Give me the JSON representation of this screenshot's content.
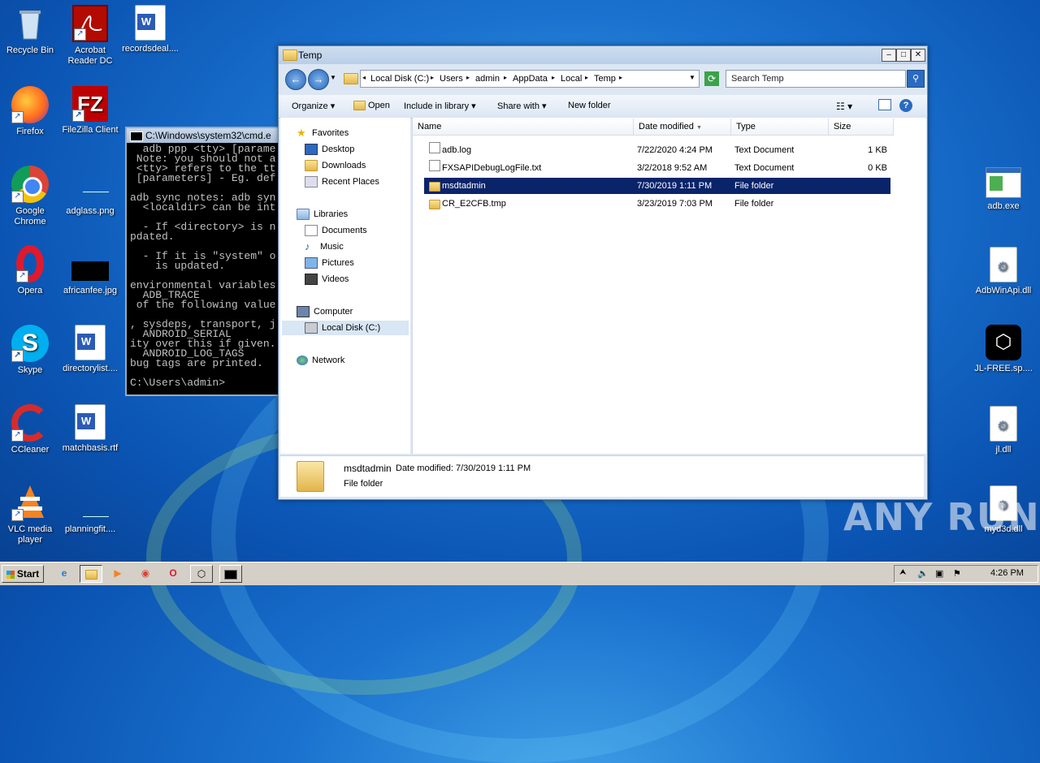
{
  "desktop": {
    "left_icons": [
      {
        "label": "Recycle Bin",
        "icon": "recycle-bin-icon"
      },
      {
        "label": "Acrobat Reader DC",
        "icon": "acrobat-icon"
      },
      {
        "label": "recordsdeal....",
        "icon": "word-doc-icon"
      },
      {
        "label": "Firefox",
        "icon": "firefox-icon"
      },
      {
        "label": "FileZilla Client",
        "icon": "filezilla-icon"
      },
      {
        "label": "Google Chrome",
        "icon": "chrome-icon"
      },
      {
        "label": "adglass.png",
        "icon": "image-file-icon"
      },
      {
        "label": "Opera",
        "icon": "opera-icon"
      },
      {
        "label": "africanfee.jpg",
        "icon": "image-file-icon"
      },
      {
        "label": "Skype",
        "icon": "skype-icon"
      },
      {
        "label": "directorylist....",
        "icon": "word-doc-icon"
      },
      {
        "label": "CCleaner",
        "icon": "ccleaner-icon"
      },
      {
        "label": "matchbasis.rtf",
        "icon": "word-doc-icon"
      },
      {
        "label": "VLC media player",
        "icon": "vlc-icon"
      },
      {
        "label": "planningfit....",
        "icon": "file-icon"
      }
    ],
    "right_icons": [
      {
        "label": "adb.exe",
        "icon": "exe-icon"
      },
      {
        "label": "AdbWinApi.dll",
        "icon": "dll-icon"
      },
      {
        "label": "JL-FREE.sp....",
        "icon": "box-icon"
      },
      {
        "label": "jl.dll",
        "icon": "dll-icon"
      },
      {
        "label": "myd3d.dll",
        "icon": "dll-icon"
      }
    ],
    "watermark": "ANY RUN"
  },
  "cmd": {
    "title": "C:\\Windows\\system32\\cmd.e",
    "lines": [
      "  adb ppp <tty> [parame",
      " Note: you should not a",
      " <tty> refers to the tt",
      " [parameters] - Eg. def",
      "",
      "adb sync notes: adb syn",
      "  <localdir> can be int",
      "",
      "  - If <directory> is n",
      "pdated.",
      "",
      "  - If it is \"system\" o",
      "    is updated.",
      "",
      "environmental variables",
      "  ADB_TRACE",
      " of the following value",
      "",
      ", sysdeps, transport, j",
      "  ANDROID_SERIAL",
      "ity over this if given.",
      "  ANDROID_LOG_TAGS",
      "bug tags are printed.",
      "",
      "C:\\Users\\admin>"
    ]
  },
  "explorer": {
    "title": "Temp",
    "breadcrumb": [
      "Local Disk (C:)",
      "Users",
      "admin",
      "AppData",
      "Local",
      "Temp"
    ],
    "search_placeholder": "Search Temp",
    "toolbar": {
      "organize": "Organize",
      "open": "Open",
      "include": "Include in library",
      "share": "Share with",
      "new_folder": "New folder"
    },
    "nav": {
      "favorites": "Favorites",
      "desktop": "Desktop",
      "downloads": "Downloads",
      "recent": "Recent Places",
      "libraries": "Libraries",
      "documents": "Documents",
      "music": "Music",
      "pictures": "Pictures",
      "videos": "Videos",
      "computer": "Computer",
      "local_disk": "Local Disk (C:)",
      "network": "Network"
    },
    "columns": {
      "name": "Name",
      "date": "Date modified",
      "type": "Type",
      "size": "Size"
    },
    "files": [
      {
        "name": "adb.log",
        "date": "7/22/2020 4:24 PM",
        "type": "Text Document",
        "size": "1 KB",
        "kind": "text"
      },
      {
        "name": "FXSAPIDebugLogFile.txt",
        "date": "3/2/2018 9:52 AM",
        "type": "Text Document",
        "size": "0 KB",
        "kind": "text"
      },
      {
        "name": "msdtadmin",
        "date": "7/30/2019 1:11 PM",
        "type": "File folder",
        "size": "",
        "kind": "folder"
      },
      {
        "name": "CR_E2CFB.tmp",
        "date": "3/23/2019 7:03 PM",
        "type": "File folder",
        "size": "",
        "kind": "folder"
      }
    ],
    "selected_index": 2,
    "details": {
      "name": "msdtadmin",
      "date_label": "Date modified:",
      "date": "7/30/2019 1:11 PM",
      "type": "File folder"
    }
  },
  "taskbar": {
    "start": "Start",
    "clock": "4:26 PM"
  }
}
